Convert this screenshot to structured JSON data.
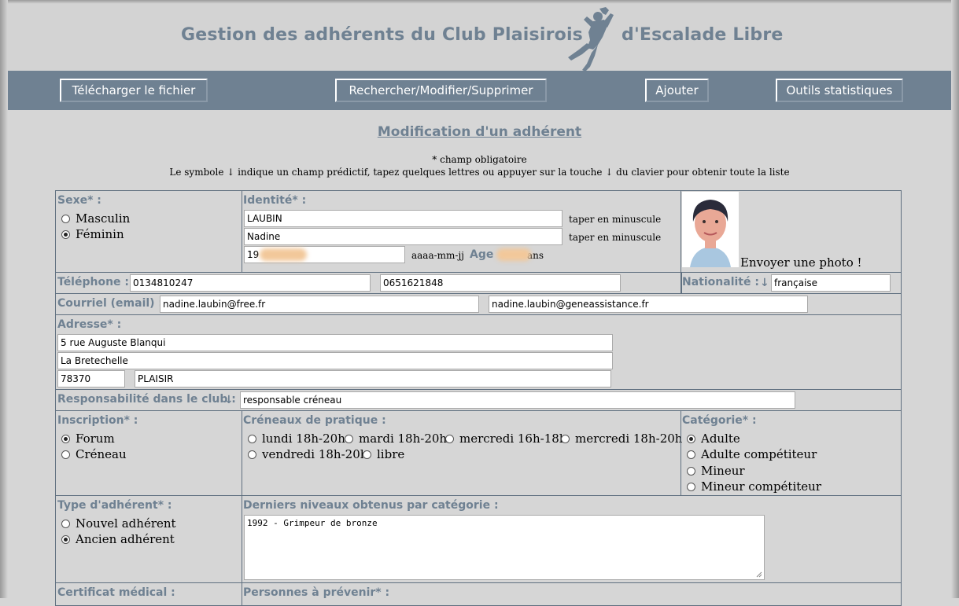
{
  "header": {
    "title_left": "Gestion des adhérents du Club Plaisirois",
    "title_right": "d'Escalade Libre"
  },
  "nav": {
    "download": "Télécharger le fichier",
    "search": "Rechercher/Modifier/Supprimer",
    "add": "Ajouter",
    "stats": "Outils statistiques"
  },
  "page": {
    "title": "Modification d'un adhérent",
    "required_note": "* champ obligatoire",
    "predict_note": "Le symbole ↓ indique un champ prédictif, tapez quelques lettres ou appuyer sur la touche ↓ du clavier pour obtenir toute la liste"
  },
  "sexe": {
    "label": "Sexe* :",
    "options": [
      "Masculin",
      "Féminin"
    ],
    "selected": "Féminin"
  },
  "identite": {
    "label": "Identité* :",
    "nom": "LAUBIN",
    "prenom": "Nadine",
    "hint_minuscule": "taper en minuscule",
    "birth_partial": "19",
    "birth_format": "aaaa-mm-jj",
    "age_label": "Age",
    "age_suffix": "ans"
  },
  "photo": {
    "send_label": "Envoyer une photo !"
  },
  "telephone": {
    "label": "Téléphone :",
    "fixe": "0134810247",
    "mobile": "0651621848"
  },
  "nationalite": {
    "label": "Nationalité :",
    "arrow": "↓",
    "value": "française"
  },
  "courriel": {
    "label": "Courriel (email) :",
    "email1": "nadine.laubin@free.fr",
    "email2": "nadine.laubin@geneassistance.fr"
  },
  "adresse": {
    "label": "Adresse* :",
    "line1": "5 rue Auguste Blanqui",
    "line2": "La Bretechelle",
    "cp": "78370",
    "ville": "PLAISIR"
  },
  "responsabilite": {
    "label": "Responsabilité dans le club :",
    "arrow": "↓",
    "value": "responsable créneau"
  },
  "inscription": {
    "label": "Inscription* :",
    "options": [
      "Forum",
      "Créneau"
    ],
    "selected": "Forum"
  },
  "creneaux": {
    "label": "Créneaux de pratique :",
    "row1": [
      "lundi 18h-20h",
      "mardi 18h-20h",
      "mercredi 16h-18h",
      "mercredi 18h-20h"
    ],
    "row2": [
      "vendredi 18h-20h",
      "libre"
    ]
  },
  "categorie": {
    "label": "Catégorie* :",
    "options": [
      "Adulte",
      "Adulte compétiteur",
      "Mineur",
      "Mineur compétiteur"
    ],
    "selected": "Adulte"
  },
  "type_adherent": {
    "label": "Type d'adhérent* :",
    "options": [
      "Nouvel adhérent",
      "Ancien adhérent"
    ],
    "selected": "Ancien adhérent"
  },
  "niveaux": {
    "label": "Derniers niveaux obtenus par catégorie :",
    "value": "1992 - Grimpeur de bronze"
  },
  "certificat": {
    "label": "Certificat médical :"
  },
  "personnes": {
    "label": "Personnes à prévenir* :"
  },
  "colors": {
    "accent": "#6f8192",
    "background": "#d6d6d6"
  }
}
